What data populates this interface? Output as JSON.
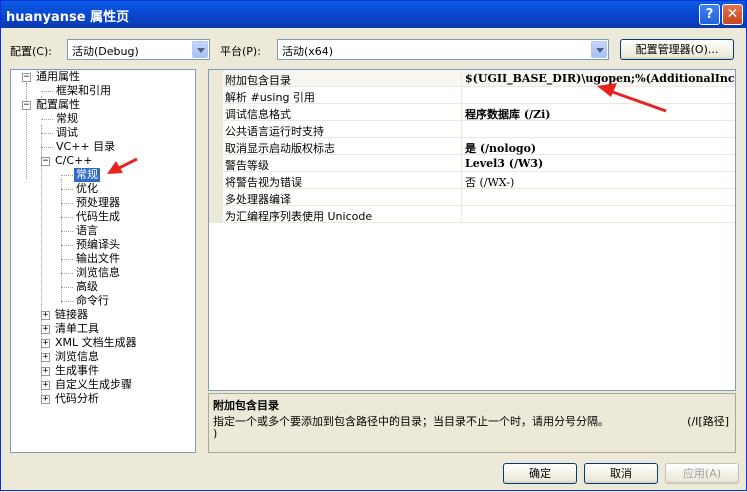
{
  "window": {
    "title": "huanyanse 属性页"
  },
  "titlebar": {
    "help": "?",
    "close": "✕"
  },
  "config": {
    "label": "配置(C):",
    "value": "活动(Debug)",
    "platform_label": "平台(P):",
    "platform_value": "活动(x64)",
    "manager_button": "配置管理器(O)..."
  },
  "tree": {
    "items": [
      {
        "label": "通用属性"
      },
      {
        "label": "框架和引用"
      },
      {
        "label": "配置属性"
      },
      {
        "label": "常规"
      },
      {
        "label": "调试"
      },
      {
        "label": "VC++ 目录"
      },
      {
        "label": "C/C++"
      },
      {
        "label": "常规"
      },
      {
        "label": "优化"
      },
      {
        "label": "预处理器"
      },
      {
        "label": "代码生成"
      },
      {
        "label": "语言"
      },
      {
        "label": "预编译头"
      },
      {
        "label": "输出文件"
      },
      {
        "label": "浏览信息"
      },
      {
        "label": "高级"
      },
      {
        "label": "命令行"
      },
      {
        "label": "链接器"
      },
      {
        "label": "清单工具"
      },
      {
        "label": "XML 文档生成器"
      },
      {
        "label": "浏览信息"
      },
      {
        "label": "生成事件"
      },
      {
        "label": "自定义生成步骤"
      },
      {
        "label": "代码分析"
      }
    ]
  },
  "properties": {
    "rows": [
      {
        "name": "附加包含目录",
        "value": "$(UGII_BASE_DIR)\\ugopen;%(AdditionalInc"
      },
      {
        "name": "解析 #using 引用",
        "value": ""
      },
      {
        "name": "调试信息格式",
        "value": "程序数据库 (/Zi)"
      },
      {
        "name": "公共语言运行时支持",
        "value": ""
      },
      {
        "name": "取消显示启动版权标志",
        "value": "是 (/nologo)"
      },
      {
        "name": "警告等级",
        "value": "Level3 (/W3)"
      },
      {
        "name": "将警告视为错误",
        "value": "否 (/WX-)"
      },
      {
        "name": "多处理器编译",
        "value": ""
      },
      {
        "name": "为汇编程序列表使用 Unicode",
        "value": ""
      }
    ]
  },
  "description": {
    "title": "附加包含目录",
    "text": "指定一个或多个要添加到包含路径中的目录；当目录不止一个时，请用分号分隔。",
    "option": "(/I[路径]",
    "close": ")"
  },
  "buttons": {
    "ok": "确定",
    "cancel": "取消",
    "apply": "应用(A)"
  },
  "colors": {
    "titlebar": "#0a4bd4",
    "selection": "#316ac5",
    "annotation_arrow": "#e8231e"
  }
}
